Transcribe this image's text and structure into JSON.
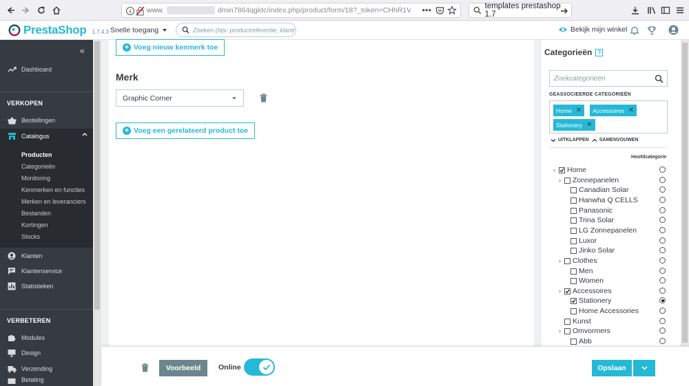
{
  "browser": {
    "url_prefix": "www.",
    "url_main": "dmin7864qgktc/index.php/product/form/18?_token=CHhR1V",
    "search_text": "templates prestashop 1.7"
  },
  "header": {
    "logo_text": "PrestaShop",
    "version": "1.7.4.3",
    "quick_access": "Snelle toegang",
    "search_placeholder": "Zoeken (bijv. productreferentie, klantnaam…)",
    "view_shop": "Bekijk mijn winkel"
  },
  "sidebar": {
    "dashboard": "Dashboard",
    "section_sales": "VERKOPEN",
    "orders": "Bestellingen",
    "catalog": "Catalogus",
    "catalog_sub": [
      "Producten",
      "Categorieën",
      "Monitoring",
      "Kenmerken en functies",
      "Merken en leveranciers",
      "Bestanden",
      "Kortingen",
      "Stocks"
    ],
    "customers": "Klanten",
    "customer_service": "Klantenservice",
    "stats": "Statistieken",
    "section_improve": "VERBETEREN",
    "modules": "Modules",
    "design": "Design",
    "shipping": "Verzending",
    "payment": "Betaling"
  },
  "main": {
    "add_feature": "Voeg nieuw kenmerk toe",
    "brand_title": "Merk",
    "brand_value": "Graphic Corner",
    "add_related": "Voeg een gerelateerd product toe"
  },
  "categories": {
    "title": "Categorieën",
    "help": "?",
    "search_placeholder": "Zoekcategorieën",
    "associated_label": "GEASSOCIEERDE CATEGORIEËN",
    "tags": [
      "Home",
      "Accessoires",
      "Stationery"
    ],
    "expand": "UITKLAPPEN",
    "collapse": "SAMENVOUWEN",
    "main_category_label": "Hoofdcategorie",
    "tree": [
      {
        "label": "Home",
        "level": 0,
        "arrow": true,
        "checked": true,
        "main": false
      },
      {
        "label": "Zonnepanelen",
        "level": 1,
        "arrow": true,
        "checked": false,
        "main": false
      },
      {
        "label": "Canadian Solar",
        "level": 2,
        "arrow": false,
        "checked": false,
        "main": false
      },
      {
        "label": "Hanwha Q CELLS",
        "level": 2,
        "arrow": false,
        "checked": false,
        "main": false
      },
      {
        "label": "Panasonic",
        "level": 2,
        "arrow": false,
        "checked": false,
        "main": false
      },
      {
        "label": "Trina Solar",
        "level": 2,
        "arrow": false,
        "checked": false,
        "main": false
      },
      {
        "label": "LG Zonnepanelen",
        "level": 2,
        "arrow": false,
        "checked": false,
        "main": false
      },
      {
        "label": "Luxor",
        "level": 2,
        "arrow": false,
        "checked": false,
        "main": false
      },
      {
        "label": "Jinko Solar",
        "level": 2,
        "arrow": false,
        "checked": false,
        "main": false
      },
      {
        "label": "Clothes",
        "level": 1,
        "arrow": true,
        "checked": false,
        "main": false
      },
      {
        "label": "Men",
        "level": 2,
        "arrow": false,
        "checked": false,
        "main": false
      },
      {
        "label": "Women",
        "level": 2,
        "arrow": false,
        "checked": false,
        "main": false
      },
      {
        "label": "Accessoires",
        "level": 1,
        "arrow": true,
        "checked": true,
        "main": false
      },
      {
        "label": "Stationery",
        "level": 2,
        "arrow": false,
        "checked": true,
        "main": true
      },
      {
        "label": "Home Accessories",
        "level": 2,
        "arrow": false,
        "checked": false,
        "main": false
      },
      {
        "label": "Kunst",
        "level": 1,
        "arrow": false,
        "checked": false,
        "main": false
      },
      {
        "label": "Omvormers",
        "level": 1,
        "arrow": true,
        "checked": false,
        "main": false
      },
      {
        "label": "Abb",
        "level": 2,
        "arrow": false,
        "checked": false,
        "main": false
      }
    ]
  },
  "footer": {
    "preview": "Voorbeeld",
    "online_label": "Online",
    "online": true,
    "save": "Opslaan"
  },
  "colors": {
    "primary": "#25b9d7",
    "sidebar_bg": "#363a41",
    "secondary": "#6c868e"
  }
}
